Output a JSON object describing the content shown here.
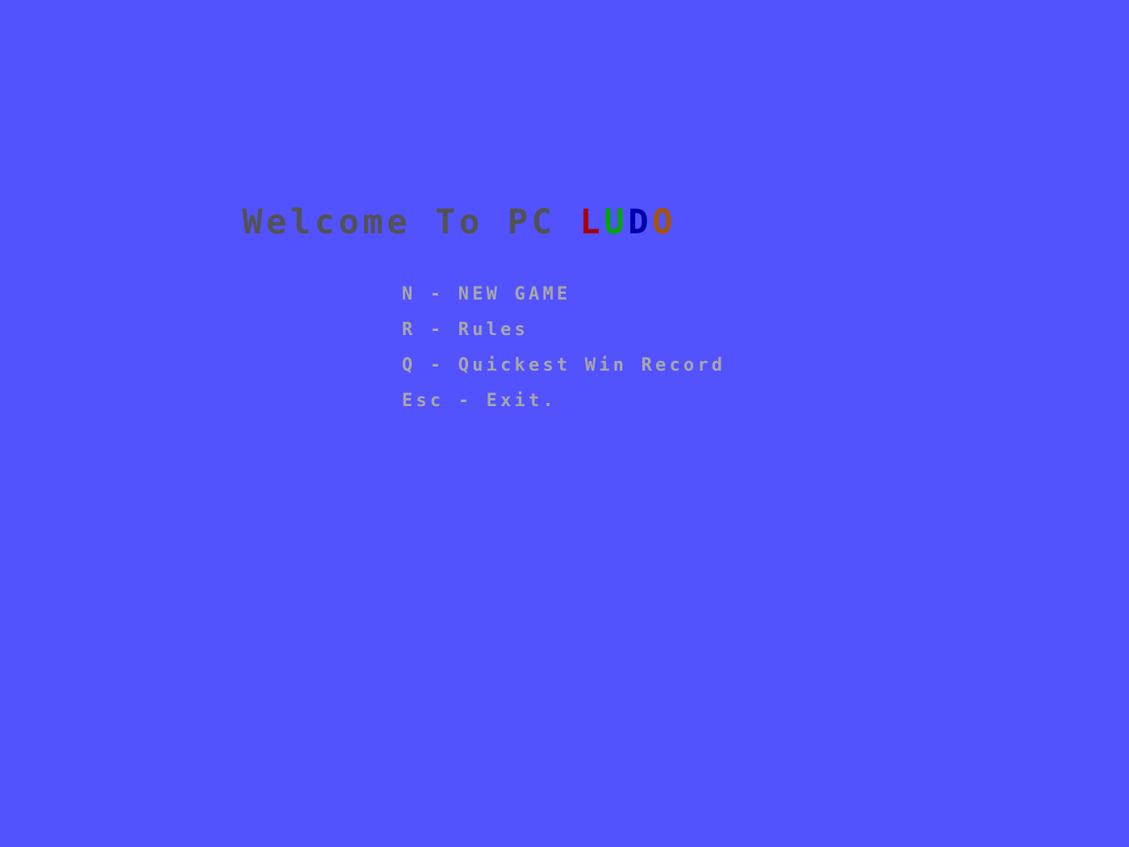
{
  "title": {
    "prefix": "Welcome To PC ",
    "ludo_letters": [
      {
        "char": "L",
        "color": "#A80000"
      },
      {
        "char": "U",
        "color": "#00A800"
      },
      {
        "char": "D",
        "color": "#0000A8"
      },
      {
        "char": "O",
        "color": "#A85400"
      }
    ]
  },
  "menu": {
    "items": [
      {
        "label": "N - NEW GAME"
      },
      {
        "label": "R - Rules"
      },
      {
        "label": "Q - Quickest Win Record"
      },
      {
        "label": "Esc - Exit."
      }
    ]
  },
  "colors": {
    "background": "#5252FF",
    "title_text": "#525252",
    "menu_text": "#A8A8A8"
  }
}
